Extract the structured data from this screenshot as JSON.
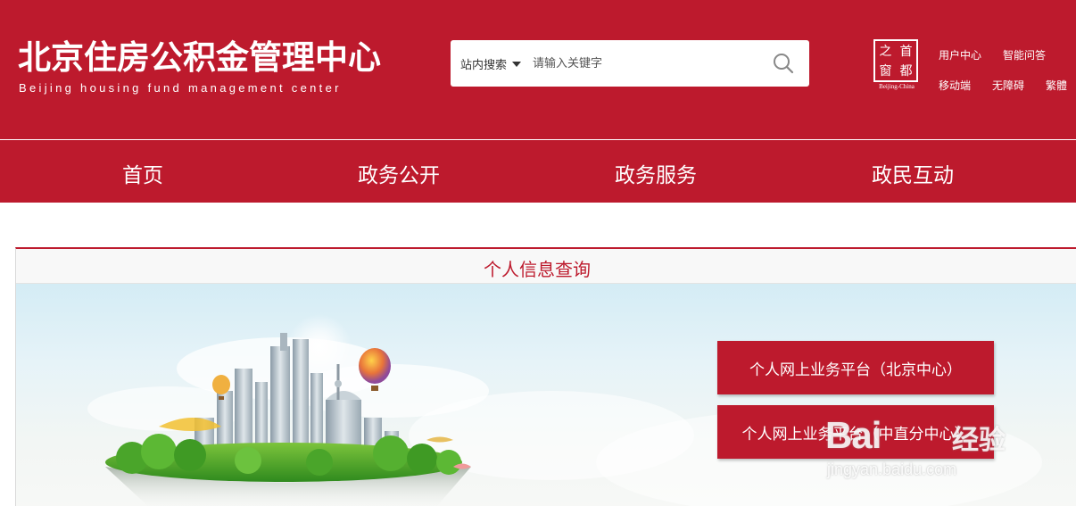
{
  "header": {
    "title_cn": "北京住房公积金管理中心",
    "title_en": "Beijing housing fund management center",
    "bg_color": "#bd1a2d"
  },
  "search": {
    "scope_label": "站内搜索",
    "placeholder": "请输入关键字",
    "button_icon": "search-icon"
  },
  "seal": {
    "chars": [
      "首",
      "都",
      "之",
      "窗"
    ],
    "caption": "Beijing-China"
  },
  "toplinks": {
    "user_center": "用户中心",
    "smart_qa": "智能问答",
    "mobile": "移动端",
    "accessibility": "无障碍",
    "traditional": "繁體"
  },
  "nav": {
    "items": [
      {
        "label": "首页"
      },
      {
        "label": "政务公开"
      },
      {
        "label": "政务服务"
      },
      {
        "label": "政民互动"
      }
    ]
  },
  "panel": {
    "title": "个人信息查询",
    "buttons": [
      {
        "label": "个人网上业务平台（北京中心）"
      },
      {
        "label": "个人网上业务平台（中直分中心）"
      }
    ]
  },
  "watermark": {
    "brand": "Bai",
    "brand_suffix": "经验",
    "url": "jingyan.baidu.com"
  }
}
